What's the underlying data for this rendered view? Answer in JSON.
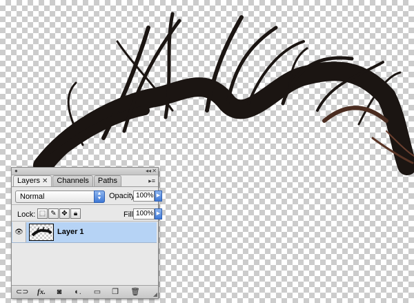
{
  "panel": {
    "tabs": [
      {
        "label": "Layers",
        "close": "✕"
      },
      {
        "label": "Channels"
      },
      {
        "label": "Paths"
      }
    ],
    "blend_mode": "Normal",
    "opacity_label": "Opacity:",
    "opacity_value": "100%",
    "lock_label": "Lock:",
    "fill_label": "Fill:",
    "fill_value": "100%",
    "layer": {
      "name": "Layer 1",
      "visible": true
    }
  },
  "icons": {
    "panel_close": "close-icon",
    "panel_collapse": "collapse-icon",
    "panel_menu": "panel-menu-icon",
    "visibility": "eye-icon",
    "lock_transparent": "lock-transparent-icon",
    "lock_image": "brush-icon",
    "lock_position": "move-icon",
    "lock_all": "lock-icon",
    "footer": [
      "link-icon",
      "fx-icon",
      "layer-mask-icon",
      "adjustment-layer-icon",
      "folder-icon",
      "new-layer-icon",
      "trash-icon"
    ]
  },
  "colors": {
    "selected_row": "#b6d3f5",
    "aqua_blue": "#3e78d6",
    "checker": "#cccccc"
  }
}
